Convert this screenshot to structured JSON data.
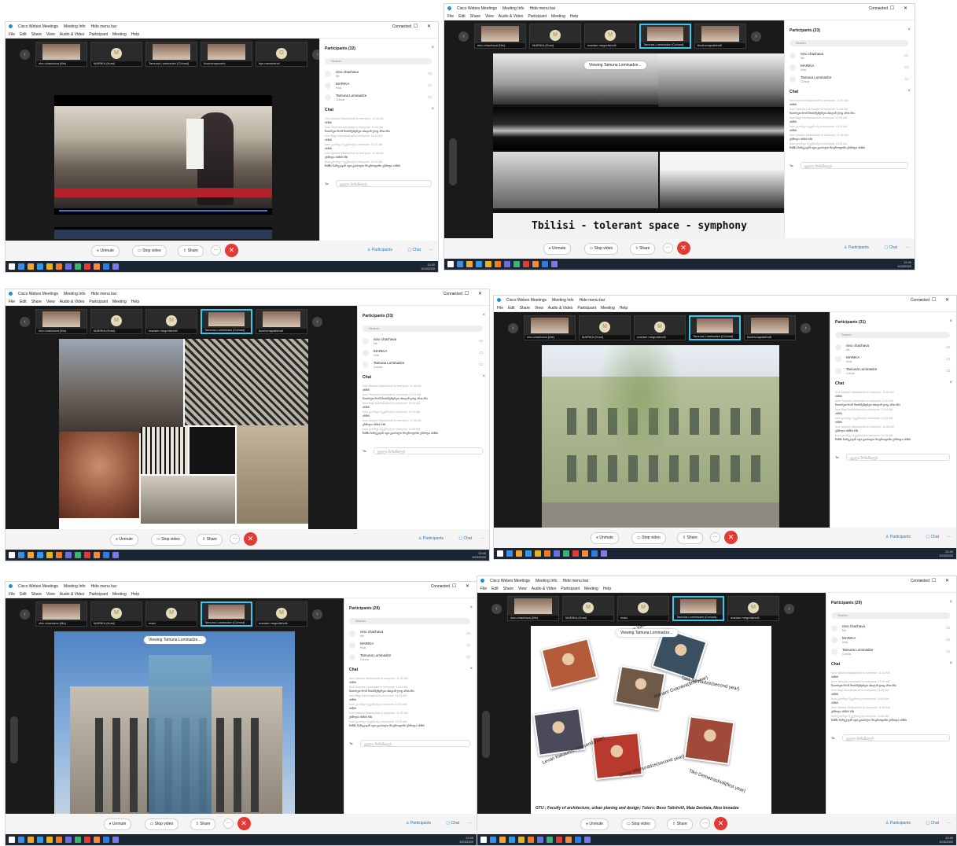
{
  "common": {
    "app_title": "Cisco Webex Meetings",
    "meeting_info": "Meeting Info",
    "hide_menu": "Hide menu bar",
    "connected": "Connected",
    "menu": [
      "File",
      "Edit",
      "Share",
      "View",
      "Audio & Video",
      "Participant",
      "Meeting",
      "Help"
    ],
    "search_placeholder": "Search",
    "chat_header": "Chat",
    "to_label": "To:",
    "to_value": "ყველა მონაწილეს",
    "unmute": "Unmute",
    "stop_video": "Stop video",
    "share": "Share",
    "participants_btn": "Participants",
    "chat_btn": "Chat",
    "time": "12:40",
    "date": "10/3/2020",
    "participants": [
      {
        "name": "nino chachava",
        "role": "Me"
      },
      {
        "name": "MARIKA",
        "role": "Host"
      },
      {
        "name": "Tamuna Lominadze",
        "role": "Cohost"
      }
    ],
    "chat_lines": [
      {
        "meta": "from Mariam Mashashvili to everyone:  11:04 AM",
        "text": "ისმის"
      },
      {
        "meta": "from Tamuna Lominadze to everyone:  11:04 AM",
        "text": "ჩაიოხეთ რომ მოისმენდნეთ ისიდან ღოც ართ ბნა"
      },
      {
        "meta": "from Bagi Kachabashvili to everyone:  11:04 AM",
        "text": "ისმის"
      },
      {
        "meta": "from გიორგი ბეკურიძე to everyone:  11:04 AM",
        "text": "ისმის"
      },
      {
        "meta": "from Mariam Mashashvili to everyone:  11:05 AM",
        "text": "ესმოდა ისმის ხმა"
      },
      {
        "meta": "from გიორგი ბეკურიძე to everyone:  11:05 AM",
        "text": "ზინმი ჩარეკაჯან იდი გაიბილი მოკროფონი ესმოდა ისმის"
      }
    ]
  },
  "panels": [
    {
      "participants_header": "Participants (32)",
      "thumbs": [
        {
          "name": "nino.chachava (Me)",
          "type": "video"
        },
        {
          "name": "MARIKA (Host)",
          "type": "avatar",
          "initial": "M"
        },
        {
          "name": "Tamuna Lominadze (Cohost)",
          "type": "video"
        },
        {
          "name": "Ikoshvnaysxehi",
          "type": "video"
        },
        {
          "name": "tiya mesurishvi",
          "type": "avatar",
          "initial": "O"
        }
      ],
      "content": "video-player"
    },
    {
      "participants_header": "Participants (33)",
      "thumbs": [
        {
          "name": "nino.chachava (Me)",
          "type": "video"
        },
        {
          "name": "MARIKA (Host)",
          "type": "avatar",
          "initial": "M"
        },
        {
          "name": "mariam megrelishvili",
          "type": "avatar",
          "initial": "M"
        },
        {
          "name": "Tamuna Lominadze (Cohost)",
          "type": "video",
          "active": true
        },
        {
          "name": "tkoshvnapaiishvili",
          "type": "video"
        }
      ],
      "viewing": "Viewing Tamuna Lominadze...",
      "caption": "Tbilisi - tolerant space - symphony",
      "content": "bw-collage"
    },
    {
      "participants_header": "Participants (33)",
      "thumbs": [
        {
          "name": "nino.chachava (Me)",
          "type": "video"
        },
        {
          "name": "MARIKA (Host)",
          "type": "avatar",
          "initial": "M"
        },
        {
          "name": "mariam megrelishvili",
          "type": "avatar",
          "initial": "M"
        },
        {
          "name": "Tamuna Lominadze (Cohost)",
          "type": "video",
          "active": true
        },
        {
          "name": "tkoshvnapaiishvili",
          "type": "video"
        }
      ],
      "content": "ornate-collage"
    },
    {
      "participants_header": "Participants (31)",
      "thumbs": [
        {
          "name": "nino.chachava (Me)",
          "type": "video"
        },
        {
          "name": "MARIKA (Host)",
          "type": "avatar",
          "initial": "M"
        },
        {
          "name": "mariam megrelishvili",
          "type": "avatar",
          "initial": "M"
        },
        {
          "name": "Tamuna Lominadze (Cohost)",
          "type": "video",
          "active": true
        },
        {
          "name": "tkoshvnapaiishvili",
          "type": "video"
        }
      ],
      "content": "green-building"
    },
    {
      "participants_header": "Participants (29)",
      "thumbs": [
        {
          "name": "zhiu.chachava (Me)",
          "type": "video"
        },
        {
          "name": "MARIKA (Host)",
          "type": "avatar",
          "initial": "M"
        },
        {
          "name": "maia",
          "type": "avatar",
          "initial": "M"
        },
        {
          "name": "Tamuna Lominadze (Cohost)",
          "type": "video",
          "active": true
        },
        {
          "name": "mariam megrelishvili",
          "type": "avatar",
          "initial": "M"
        }
      ],
      "viewing": "Viewing Tamuna Lominadze...",
      "content": "glass-building"
    },
    {
      "participants_header": "Participants (29)",
      "thumbs": [
        {
          "name": "nino.chachava (Me)",
          "type": "video"
        },
        {
          "name": "MARIKA (Host)",
          "type": "avatar",
          "initial": "M"
        },
        {
          "name": "maia",
          "type": "avatar",
          "initial": "M"
        },
        {
          "name": "Tamuna Lominadze (Cohost)",
          "type": "video",
          "active": true
        },
        {
          "name": "mariam megrelishvili",
          "type": "avatar",
          "initial": "M"
        }
      ],
      "viewing": "Viewing Tamuna Lominadze...",
      "content": "students-slide",
      "students": [
        "Giorgi Vardishvili(first year)",
        "Tata Samadze(second year)",
        "Mariam Gvazava(first year)",
        "Levan Kakauridze(second year)",
        "Giorgi Mamuradze(second year)",
        "Tiko Demetrashvili(first year)"
      ],
      "footer": "GTU ; Faculty of architecture, urban planing and design; Tutors: Beso Tatishvili, Maia Davitaia, Nino Imnadze"
    }
  ]
}
